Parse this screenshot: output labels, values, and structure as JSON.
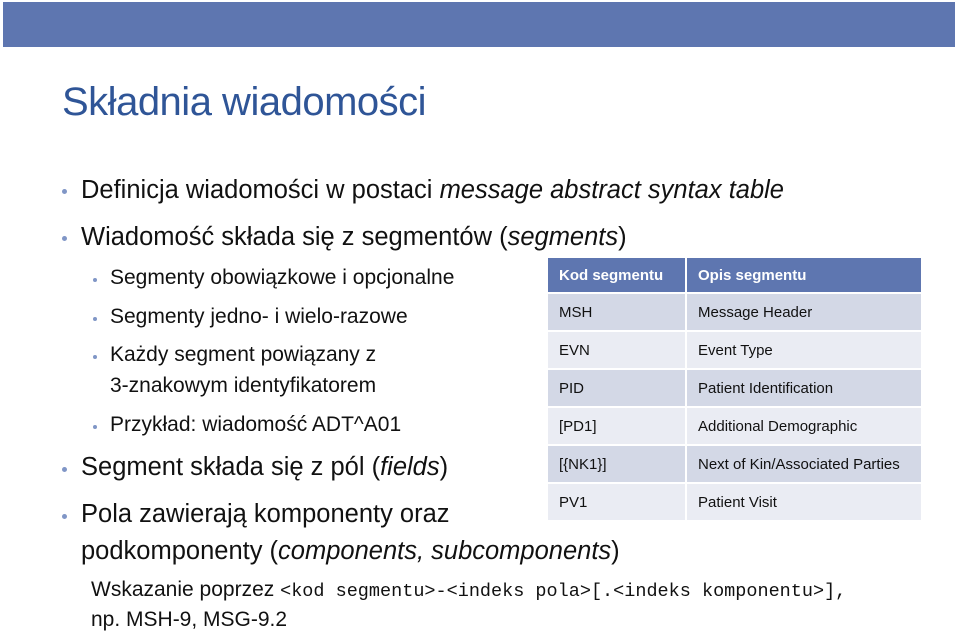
{
  "slide": {
    "title": "Składnia wiadomości",
    "colors": {
      "band": "#5e76b0",
      "title": "#2f5597",
      "bullet": "#8096c6",
      "table_header": "#5e76b0",
      "row_dark": "#d3d8e6",
      "row_light": "#eaecf3"
    },
    "bullets": [
      {
        "pre": "Definicja wiadomości w postaci ",
        "em": "message abstract syntax table",
        "post": ""
      },
      {
        "pre": "Wiadomość składa się z segmentów (",
        "em": "segments",
        "post": ")"
      }
    ],
    "sub_bullets": [
      "Segmenty obowiązkowe i opcjonalne",
      "Segmenty jedno- i wielo-razowe",
      "Każdy segment powiązany z",
      "3-znakowym identyfikatorem",
      "Przykład: wiadomość ADT^A01"
    ],
    "bullet3": {
      "pre": "Segment składa się z pól (",
      "em": "fields",
      "post": ")"
    },
    "bullet4": {
      "line1": "Pola zawierają komponenty oraz",
      "pre": "podkomponenty (",
      "em": "components, subcomponents",
      "post": ")"
    },
    "note": {
      "lead": "Wskazanie poprzez ",
      "code": "<kod segmentu>-<indeks pola>[.<indeks komponentu>],",
      "example": "np. MSH-9, MSG-9.2"
    }
  },
  "table": {
    "headers": [
      "Kod segmentu",
      "Opis segmentu"
    ],
    "rows": [
      [
        "MSH",
        "Message Header"
      ],
      [
        "EVN",
        "Event Type"
      ],
      [
        "PID",
        "Patient Identification"
      ],
      [
        "[PD1]",
        "Additional Demographic"
      ],
      [
        "[{NK1}]",
        "Next of Kin/Associated Parties"
      ],
      [
        "PV1",
        "Patient Visit"
      ]
    ]
  }
}
